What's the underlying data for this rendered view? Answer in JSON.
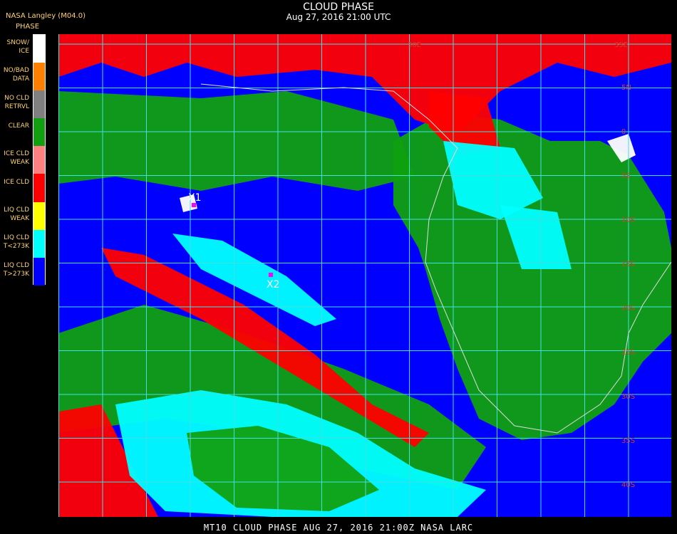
{
  "header": {
    "title": "CLOUD PHASE",
    "subtitle": "Aug 27, 2016 21:00 UTC",
    "agency": "NASA Langley (M04.0)"
  },
  "legend": {
    "title": "PHASE",
    "items": [
      {
        "label": "SNOW/\nICE",
        "color": "#ffffff"
      },
      {
        "label": "NO/BAD\nDATA",
        "color": "#ff8000"
      },
      {
        "label": "NO CLD\nRETRVL",
        "color": "#808080"
      },
      {
        "label": "CLEAR",
        "color": "#10a010"
      },
      {
        "label": "ICE CLD\nWEAK",
        "color": "#ff8080"
      },
      {
        "label": "ICE CLD",
        "color": "#ff0000"
      },
      {
        "label": "LIQ CLD\nWEAK",
        "color": "#ffff00"
      },
      {
        "label": "LIQ CLD\nT<273K",
        "color": "#00ffff"
      },
      {
        "label": "LIQ CLD\nT>273K",
        "color": "#0000ff"
      }
    ]
  },
  "map": {
    "lat_labels": [
      "30E",
      "35E",
      "5N",
      "0",
      "5S",
      "10S",
      "15S",
      "20S",
      "25S",
      "30S",
      "35S",
      "40S"
    ],
    "lon_label_top": "30E",
    "markers": [
      {
        "label": "X1"
      },
      {
        "label": "X2"
      }
    ],
    "colors": {
      "ocean_liq_warm": "#0000ff",
      "clear": "#10a010",
      "ice": "#ff0000",
      "liq_cold": "#00ffff",
      "snow_ice": "#ffffff",
      "grid": "#40e0e0",
      "marker": "#ff00ff"
    }
  },
  "footer": {
    "text": "MT10  CLOUD PHASE   AUG 27, 2016 21:00Z   NASA LARC"
  }
}
